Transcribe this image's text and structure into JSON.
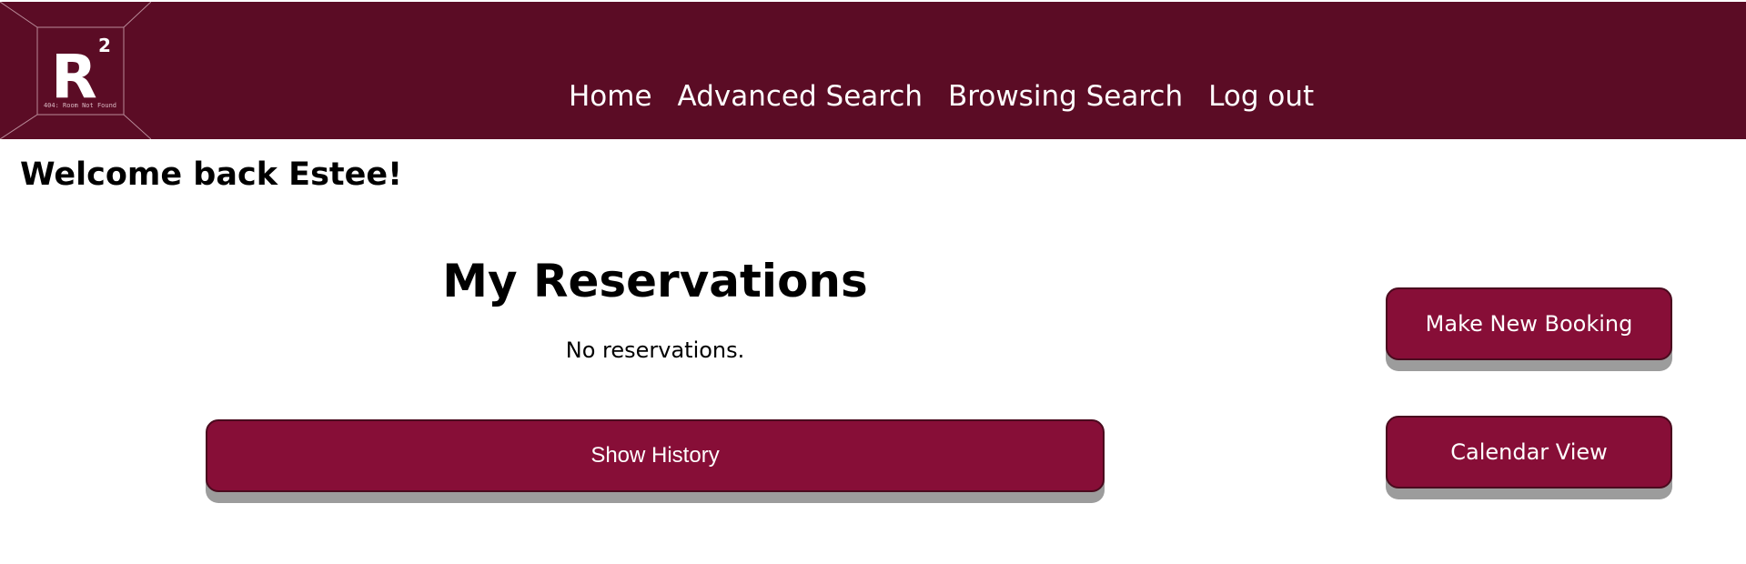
{
  "header": {
    "logo_text": "R",
    "logo_superscript": "2",
    "logo_tagline": "404: Room Not Found",
    "nav": [
      {
        "label": "Home",
        "name": "nav-home"
      },
      {
        "label": "Advanced Search",
        "name": "nav-advanced-search"
      },
      {
        "label": "Browsing Search",
        "name": "nav-browsing-search"
      },
      {
        "label": "Log out",
        "name": "nav-log-out"
      }
    ]
  },
  "main": {
    "welcome": "Welcome back Estee!",
    "reservations_title": "My Reservations",
    "reservations_empty": "No reservations.",
    "show_history_label": "Show History",
    "make_booking_label": "Make New Booking",
    "calendar_view_label": "Calendar View"
  },
  "colors": {
    "header_bg": "#5b0c25",
    "button_bg": "#870e37",
    "button_shadow": "#9c9c9c"
  }
}
